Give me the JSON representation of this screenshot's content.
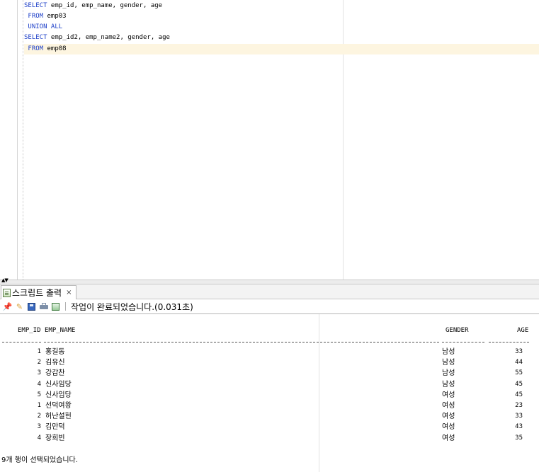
{
  "editor": {
    "lines": [
      {
        "kw": "SELECT",
        "rest": " emp_id, emp_name, gender, age"
      },
      {
        "kw": " FROM",
        "rest": " emp03"
      },
      {
        "kw": " UNION ALL",
        "rest": ""
      },
      {
        "kw": "SELECT",
        "rest": " emp_id2, emp_name2, gender, age"
      },
      {
        "kw": " FROM",
        "rest": " emp08"
      }
    ]
  },
  "output_tab": {
    "label": "스크립트 출력",
    "close": "×"
  },
  "toolbar": {
    "status": "작업이 완료되었습니다.(0.031초)"
  },
  "result": {
    "columns": [
      "EMP_ID",
      "EMP_NAME",
      "GENDER",
      "AGE"
    ],
    "rows": [
      {
        "id": "1",
        "name": "홍길동",
        "gender": "남성",
        "age": "33"
      },
      {
        "id": "2",
        "name": "김유신",
        "gender": "남성",
        "age": "44"
      },
      {
        "id": "3",
        "name": "강감찬",
        "gender": "남성",
        "age": "55"
      },
      {
        "id": "4",
        "name": "신사임당",
        "gender": "남성",
        "age": "45"
      },
      {
        "id": "5",
        "name": "신사임당",
        "gender": "여성",
        "age": "45"
      },
      {
        "id": "1",
        "name": "선덕여왕",
        "gender": "여성",
        "age": "23"
      },
      {
        "id": "2",
        "name": "허난설헌",
        "gender": "여성",
        "age": "33"
      },
      {
        "id": "3",
        "name": "김만덕",
        "gender": "여성",
        "age": "43"
      },
      {
        "id": "4",
        "name": "장희빈",
        "gender": "여성",
        "age": "35"
      }
    ],
    "summary": "9개 행이 선택되었습니다."
  }
}
